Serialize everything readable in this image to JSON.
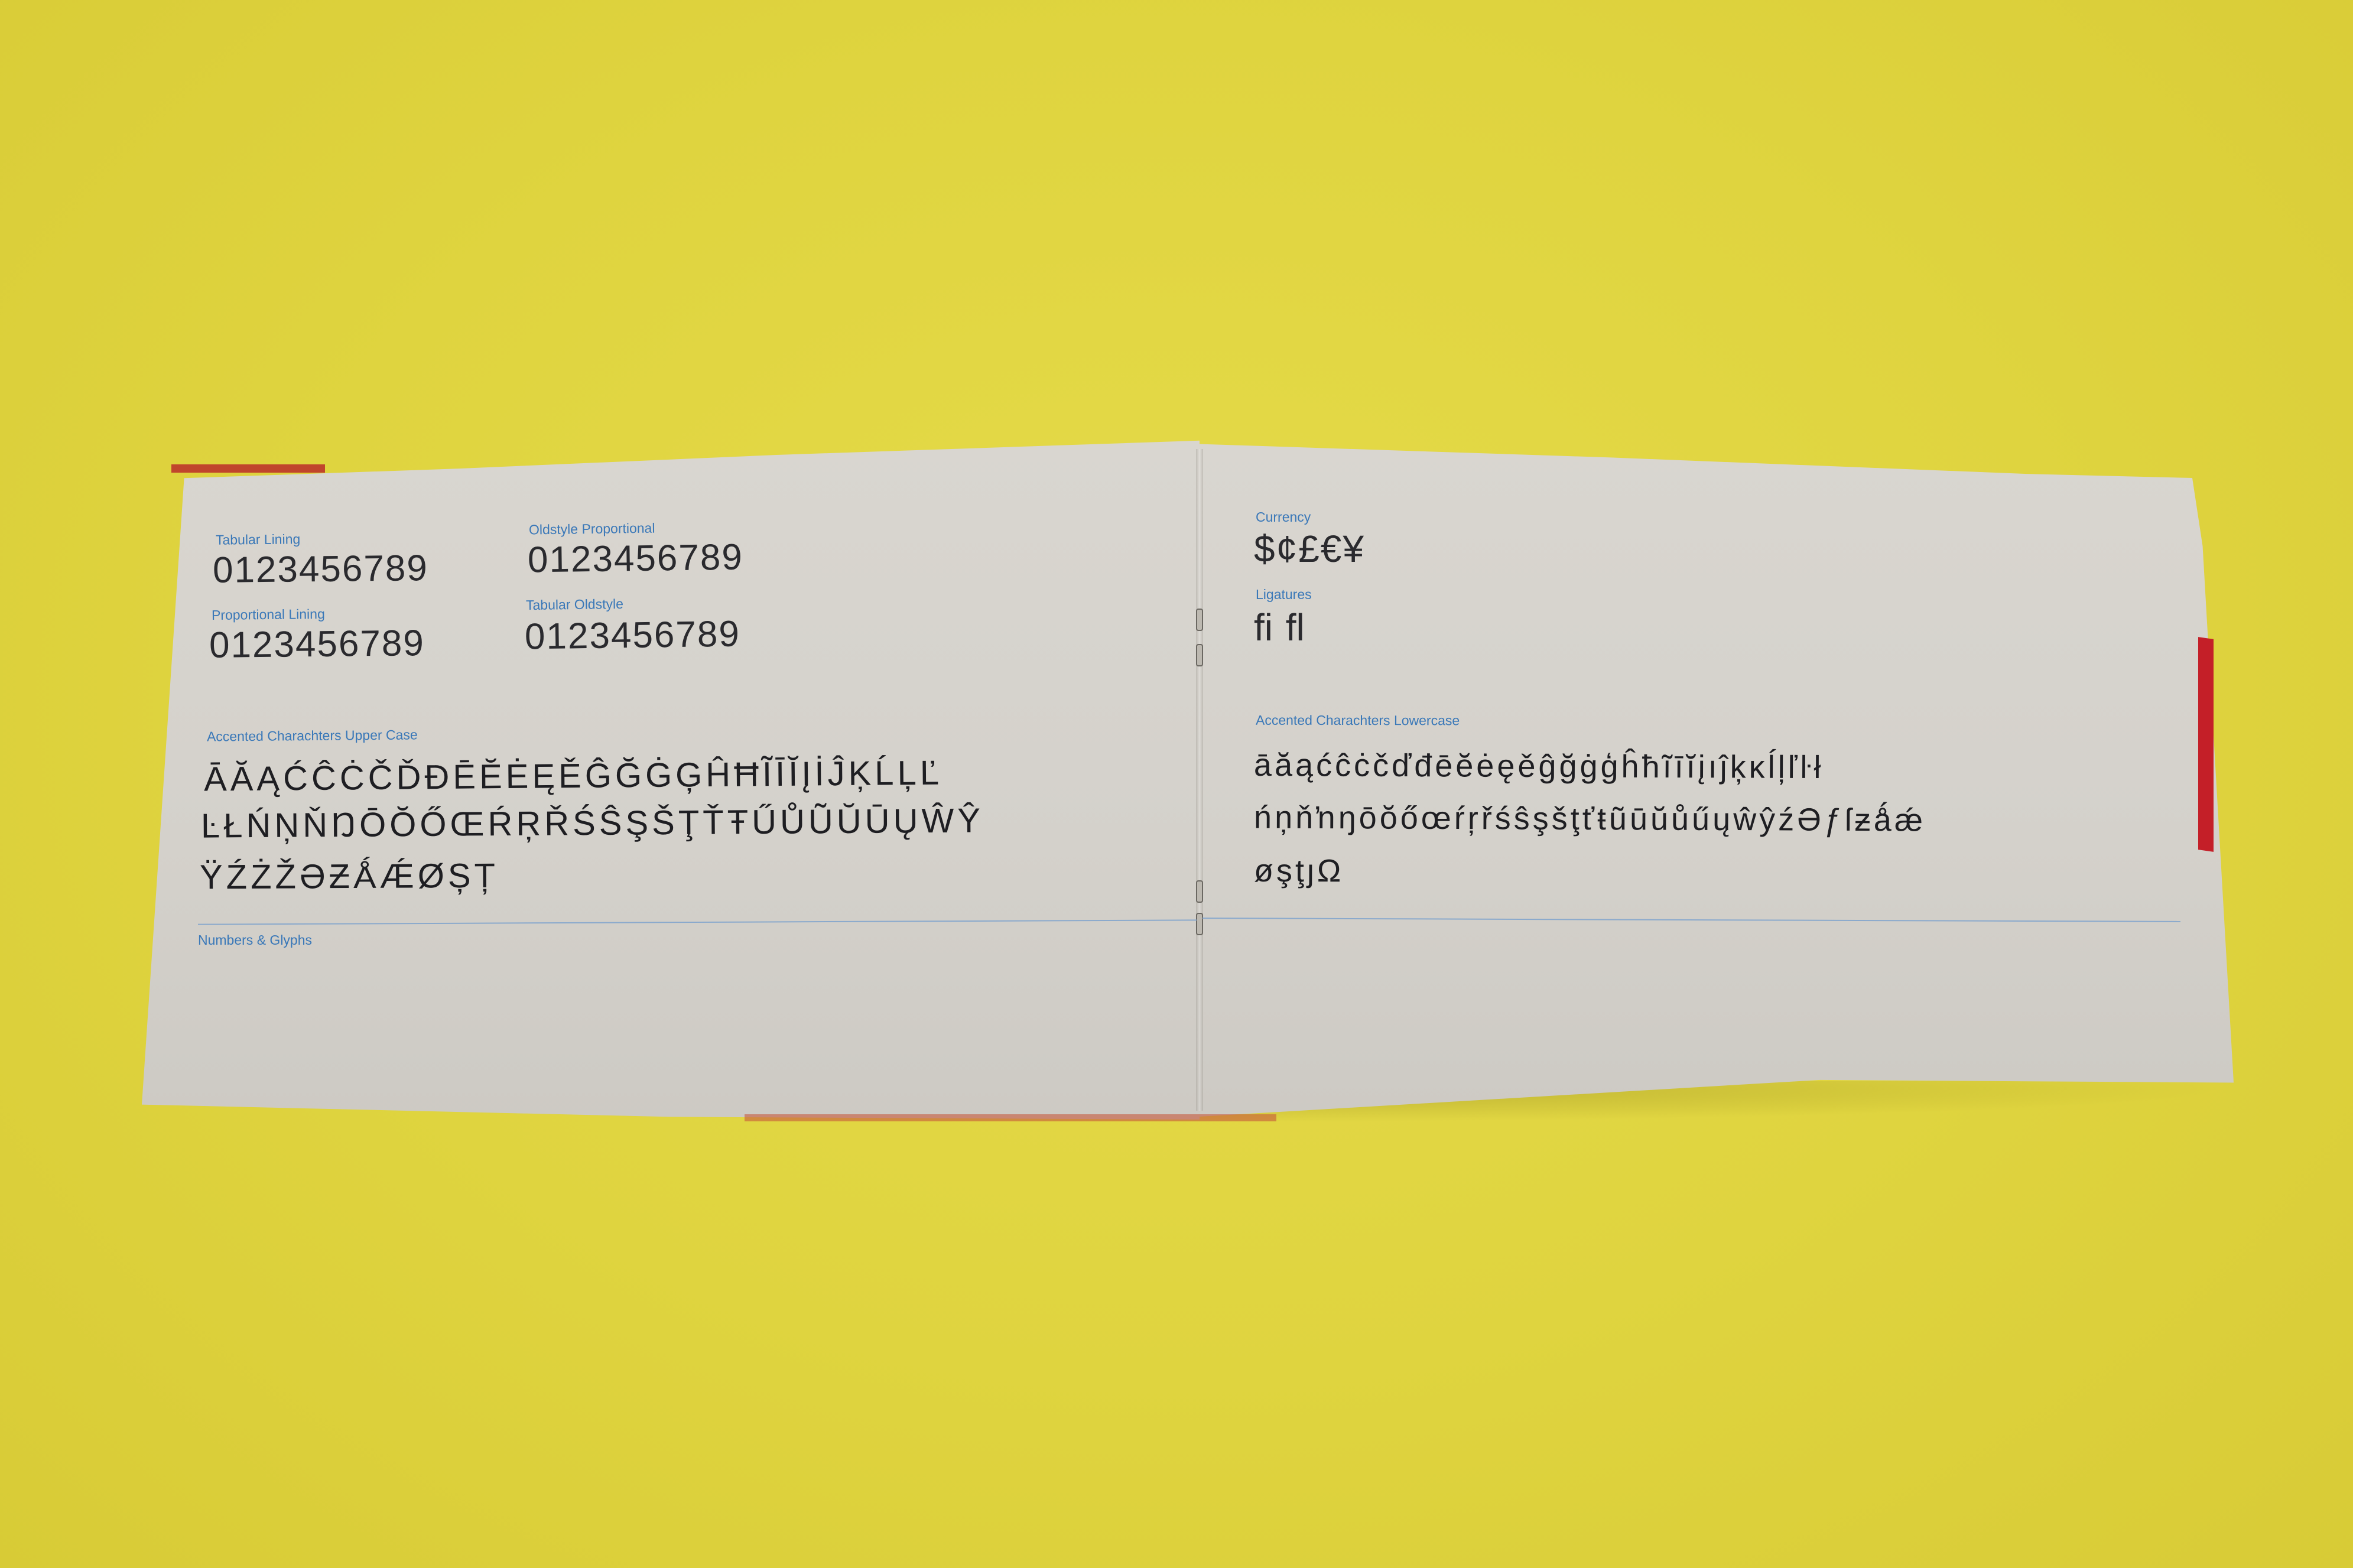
{
  "left_page": {
    "tabular_lining": {
      "label": "Tabular Lining",
      "value": "0123456789"
    },
    "proportional_lining": {
      "label": "Proportional Lining",
      "value": "0123456789"
    },
    "oldstyle_proportional": {
      "label": "Oldstyle Proportional",
      "value": "0123456789"
    },
    "tabular_oldstyle": {
      "label": "Tabular Oldstyle",
      "value": "0123456789"
    },
    "uppercase": {
      "label": "Accented Charachters Upper Case",
      "lines": [
        "ĀĂĄĆĈĊČĎĐĒĔĖĘĚĜĞĠĢĤĦĨĪĬĮİĴĶĹĻĽ",
        "ĿŁŃŅŇŊŌŎŐŒŔŖŘŚŜŞŠŢŤŦŰŮŨŬŪŲŴŶ",
        "ŸŹŻŽƏƵǺǼØȘȚ"
      ]
    },
    "section_title": "Numbers & Glyphs"
  },
  "right_page": {
    "currency": {
      "label": "Currency",
      "value": "$¢£€¥"
    },
    "ligatures": {
      "label": "Ligatures",
      "value": "ﬁ ﬂ"
    },
    "lowercase": {
      "label": "Accented Charachters Lowercase",
      "lines": [
        "āăąćĉċčďđēĕėęěĝğġģĥħĩīĭįıĵķĸĺļľŀł",
        "ńņňŉŋōŏőœŕŗřśŝşšţťŧũūŭůűųŵŷźƏƒſƶǻǽ",
        "øşţȷΩ"
      ]
    }
  },
  "colors": {
    "background": "#dfd43f",
    "paper": "#d6d3cd",
    "label_blue": "#3a78b8",
    "ink": "#1e1e22",
    "rule_blue": "#8aa9cc",
    "edge_red": "#c41f28"
  }
}
